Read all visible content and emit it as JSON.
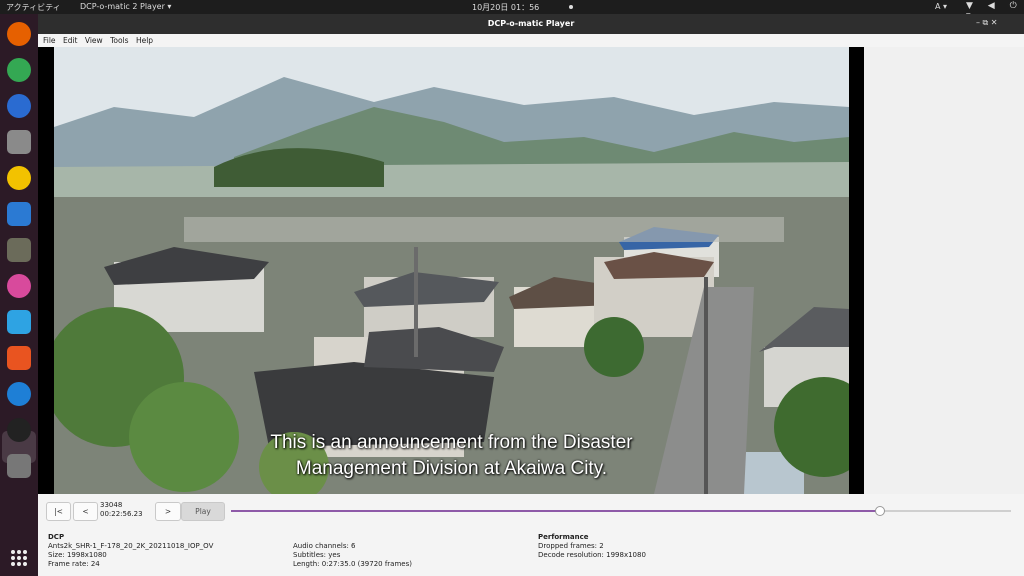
{
  "topbar": {
    "activities": "アクティビティ",
    "app_menu": "DCP-o-matic 2 Player ▾",
    "clock": "10月20日 01：56",
    "lang": "A ▾",
    "sys_icons": "▼ ◀ ⏻ ▾"
  },
  "dock": {
    "items": [
      {
        "name": "firefox",
        "color": "#e66000"
      },
      {
        "name": "chrome",
        "color": "#34a853"
      },
      {
        "name": "thunderbird",
        "color": "#2a6bd1"
      },
      {
        "name": "files",
        "color": "#8a8a8a"
      },
      {
        "name": "rhythmbox",
        "color": "#f2c200"
      },
      {
        "name": "writer",
        "color": "#2b7ad3"
      },
      {
        "name": "gimp",
        "color": "#6b6b5a"
      },
      {
        "name": "colors",
        "color": "#d84a9c"
      },
      {
        "name": "app-y",
        "color": "#2ea3e3"
      },
      {
        "name": "software",
        "color": "#e95420"
      },
      {
        "name": "help",
        "color": "#1e7fd6"
      },
      {
        "name": "dcpomatic",
        "color": "#222222"
      },
      {
        "name": "usb",
        "color": "#777777"
      }
    ]
  },
  "window": {
    "title": "DCP-o-matic Player",
    "controls": "–  ⧉  ✕"
  },
  "menu": [
    "File",
    "Edit",
    "View",
    "Tools",
    "Help"
  ],
  "video": {
    "subtitle_line1": "This is an announcement from the Disaster",
    "subtitle_line2": "Management Division at Akaiwa City."
  },
  "playback": {
    "btn_start": "|<",
    "btn_back": "<",
    "frame": "33048",
    "timecode": "00:22:56.23",
    "btn_forward": ">",
    "btn_play": "Play",
    "position_fraction": 0.832
  },
  "info": {
    "dcp_title": "DCP",
    "dcp_name": "Ants2k_SHR-1_F-178_20_2K_20211018_IOP_OV",
    "size": "Size: 1998x1080",
    "frame_rate": "Frame rate: 24",
    "audio_channels": "Audio channels: 6",
    "subtitles": "Subtitles: yes",
    "length": "Length: 0:27:35.0 (39720 frames)",
    "perf_title": "Performance",
    "dropped": "Dropped frames: 2",
    "decode_res": "Decode resolution: 1998x1080"
  },
  "colors": {
    "accent": "#8e5aa8",
    "dock_bg": "#2c1a26",
    "titlebar_bg": "#2e2e2e"
  }
}
